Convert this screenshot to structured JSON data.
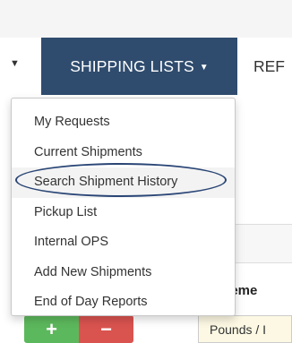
{
  "navbar": {
    "shipping_lists_label": "SHIPPING LISTS",
    "reports_label": "REF"
  },
  "dropdown": {
    "items": [
      {
        "label": "My Requests"
      },
      {
        "label": "Current Shipments"
      },
      {
        "label": "Search Shipment History"
      },
      {
        "label": "Pickup List"
      },
      {
        "label": "Internal OPS"
      },
      {
        "label": "Add New Shipments"
      },
      {
        "label": "End of Day Reports"
      }
    ]
  },
  "table": {
    "measurement_header": "sureme",
    "units_value": "Pounds / I"
  },
  "buttons": {
    "plus": "+",
    "minus": "−"
  },
  "colors": {
    "nav_active": "#2f4c6e",
    "plus_button": "#5cb85c",
    "minus_button": "#d9534f",
    "annotation_ellipse": "#2a4676"
  }
}
